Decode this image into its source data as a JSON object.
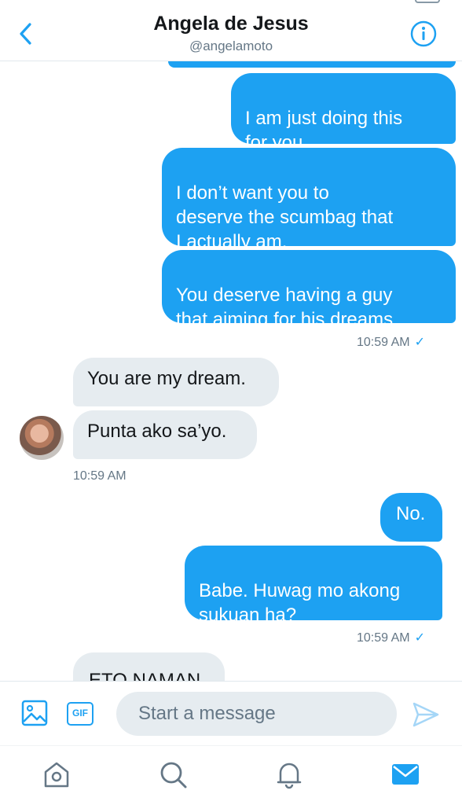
{
  "header": {
    "title": "Angela de Jesus",
    "handle": "@angelamoto",
    "back_icon": "chevron-left-icon",
    "info_icon": "info-icon"
  },
  "messages": [
    {
      "direction": "outgoing",
      "text": "I am just doing this\nfor you."
    },
    {
      "direction": "outgoing",
      "text": "I don’t want you to\ndeserve the scumbag that\nI actually am."
    },
    {
      "direction": "outgoing",
      "text": "You deserve having a guy\nthat aiming for his dreams."
    },
    {
      "direction": "outgoing",
      "timestamp": "10:59 AM",
      "status": "✓"
    },
    {
      "direction": "incoming",
      "text": "You are my dream."
    },
    {
      "direction": "incoming",
      "text": "Punta ako sa’yo."
    },
    {
      "direction": "incoming",
      "timestamp": "10:59 AM"
    },
    {
      "direction": "outgoing",
      "text": "No."
    },
    {
      "direction": "outgoing",
      "text": "Babe. Huwag mo akong\nsukuan ha?"
    },
    {
      "direction": "outgoing",
      "timestamp": "10:59 AM",
      "status": "✓"
    },
    {
      "direction": "incoming",
      "text": "ETO NAMAN"
    }
  ],
  "composer": {
    "placeholder": "Start a message",
    "gif_label": "GIF"
  },
  "tabbar": {
    "items": [
      "home-icon",
      "search-icon",
      "notifications-icon",
      "messages-icon"
    ],
    "active": "messages-icon"
  },
  "colors": {
    "accent": "#1da1f2",
    "incoming_bubble": "#e6ecf0",
    "secondary_text": "#657786"
  }
}
